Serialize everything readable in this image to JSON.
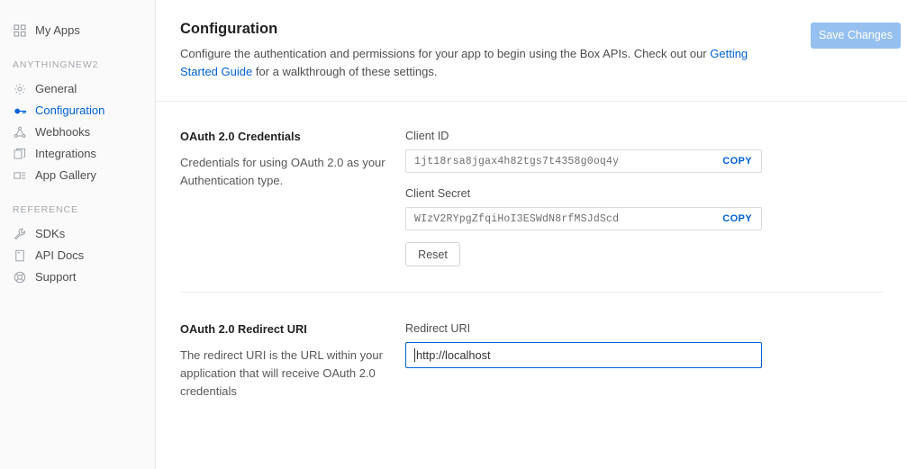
{
  "sidebar": {
    "top_item": {
      "label": "My Apps",
      "icon": "grid-icon"
    },
    "app_section_label": "ANYTHINGNEW2",
    "app_items": [
      {
        "label": "General",
        "icon": "gear-icon",
        "active": false
      },
      {
        "label": "Configuration",
        "icon": "key-icon",
        "active": true
      },
      {
        "label": "Webhooks",
        "icon": "webhook-icon",
        "active": false
      },
      {
        "label": "Integrations",
        "icon": "integrations-icon",
        "active": false
      },
      {
        "label": "App Gallery",
        "icon": "app-gallery-icon",
        "active": false
      }
    ],
    "reference_section_label": "REFERENCE",
    "reference_items": [
      {
        "label": "SDKs",
        "icon": "wrench-icon"
      },
      {
        "label": "API Docs",
        "icon": "document-icon"
      },
      {
        "label": "Support",
        "icon": "life-preserver-icon"
      }
    ]
  },
  "header": {
    "title": "Configuration",
    "description_before_link": "Configure the authentication and permissions for your app to begin using the Box APIs. Check out our ",
    "link_text": "Getting Started Guide",
    "description_after_link": " for a walkthrough of these settings.",
    "save_label": "Save Changes"
  },
  "credentials_section": {
    "title": "OAuth 2.0 Credentials",
    "description": "Credentials for using OAuth 2.0 as your Authentication type.",
    "client_id_label": "Client ID",
    "client_id_value": "1jt18rsa8jgax4h82tgs7t4358g0oq4y",
    "client_id_copy_label": "COPY",
    "client_secret_label": "Client Secret",
    "client_secret_value": "WIzV2RYpgZfqiHoI3ESWdN8rfMSJdScd",
    "client_secret_copy_label": "COPY",
    "reset_label": "Reset"
  },
  "redirect_section": {
    "title": "OAuth 2.0 Redirect URI",
    "description": "The redirect URI is the URL within your application that will receive OAuth 2.0 credentials",
    "field_label": "Redirect URI",
    "field_value": "http://localhost"
  },
  "colors": {
    "accent": "#0061d5",
    "save_button": "#96c0f0",
    "sidebar_bg": "#fafafa",
    "text": "#4e4e4e"
  }
}
